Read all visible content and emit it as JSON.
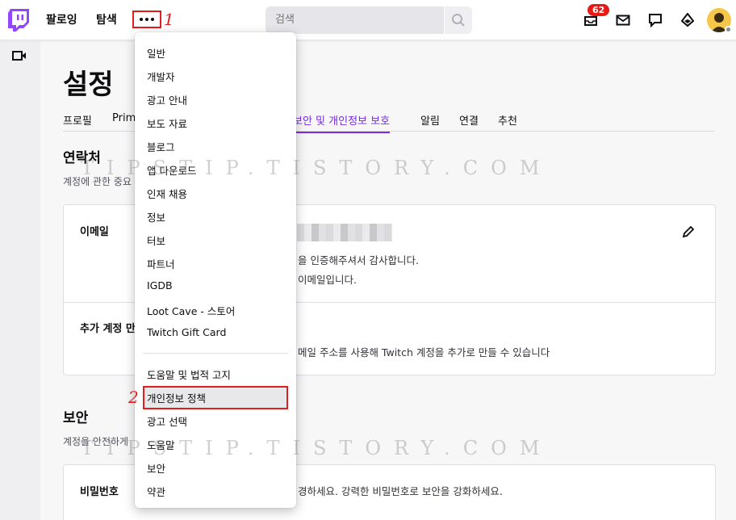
{
  "colors": {
    "brand": "#9146ff",
    "accent": "#772ce8",
    "annotation": "#e01e1e",
    "badge": "#e91916"
  },
  "topnav": {
    "logo_icon": "twitch-logo-icon",
    "links": [
      "팔로잉",
      "탐색"
    ],
    "more_icon": "more-dots-icon",
    "annotation_1": "1",
    "search_placeholder": "검색",
    "search_icon": "search-icon",
    "notification_badge": "62",
    "icons": [
      "notifications-icon",
      "inbox-icon",
      "whispers-icon",
      "bits-icon"
    ],
    "avatar_icon": "user-avatar-icon"
  },
  "sidebar": {
    "icon": "video-camera-icon"
  },
  "main": {
    "page_title": "설정",
    "tabs": [
      {
        "label": "프로필",
        "active": false
      },
      {
        "label": "Prim",
        "active": false
      },
      {
        "label": "보안 및 개인정보 보호",
        "active": true
      },
      {
        "label": "알림",
        "active": false
      },
      {
        "label": "연결",
        "active": false
      },
      {
        "label": "추천",
        "active": false
      }
    ],
    "contact": {
      "title": "연락처",
      "desc": "계정에 관한 중요",
      "email_label": "이메일",
      "email_line1": "을 인증해주셔서 감사합니다.",
      "email_line2": "이메일입니다.",
      "extra_label": "추가 계정 만",
      "extra_text": "메일 주소를 사용해 Twitch 계정을 추가로 만들 수 있습니다"
    },
    "security": {
      "title": "보안",
      "desc": "계정을 안전하게",
      "password_label": "비밀번호",
      "password_text": "경하세요. 강력한 비밀번호로 보안을 강화하세요."
    }
  },
  "dropdown": {
    "items_top": [
      "일반",
      "개발자",
      "광고 안내",
      "보도 자료",
      "블로그",
      "앱 다운로드",
      "인재 채용",
      "정보",
      "터보",
      "파트너",
      "IGDB",
      "Loot Cave - 스토어",
      "Twitch Gift Card"
    ],
    "items_bottom": [
      "도움말 및 법적 고지",
      "개인정보 정책",
      "광고 선택",
      "도움말",
      "보안",
      "약관"
    ],
    "annotation_2": "2"
  },
  "watermark": "TIPSTIP.TISTORY.COM"
}
